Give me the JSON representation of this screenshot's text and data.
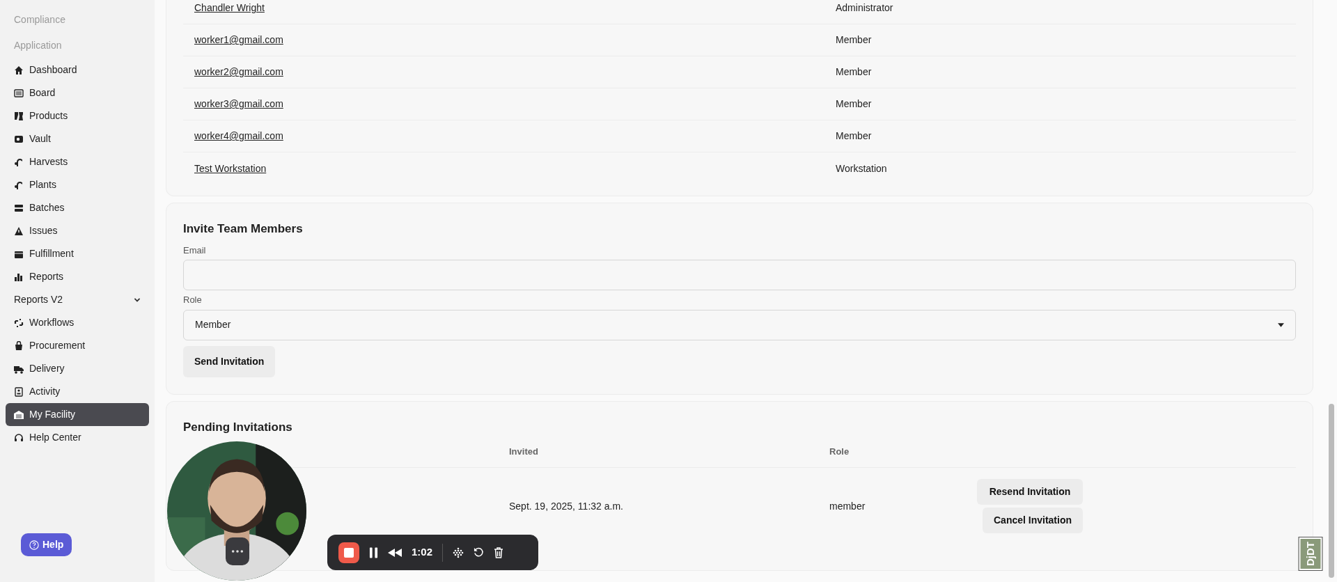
{
  "sidebar": {
    "sections": [
      {
        "label": "Compliance"
      },
      {
        "label": "Application"
      }
    ],
    "items": [
      {
        "label": "Dashboard",
        "kind": "link",
        "selected": false
      },
      {
        "label": "Board",
        "kind": "link",
        "selected": false
      },
      {
        "label": "Products",
        "kind": "link",
        "selected": false
      },
      {
        "label": "Vault",
        "kind": "link",
        "selected": false
      },
      {
        "label": "Harvests",
        "kind": "link",
        "selected": false
      },
      {
        "label": "Plants",
        "kind": "link",
        "selected": false
      },
      {
        "label": "Batches",
        "kind": "link",
        "selected": false
      },
      {
        "label": "Issues",
        "kind": "link",
        "selected": false
      },
      {
        "label": "Fulfillment",
        "kind": "link",
        "selected": false
      },
      {
        "label": "Reports",
        "kind": "link",
        "selected": false
      },
      {
        "label": "Reports V2",
        "kind": "group",
        "selected": false
      },
      {
        "label": "Workflows",
        "kind": "link",
        "selected": false
      },
      {
        "label": "Procurement",
        "kind": "link",
        "selected": false
      },
      {
        "label": "Delivery",
        "kind": "link",
        "selected": false
      },
      {
        "label": "Activity",
        "kind": "link",
        "selected": false
      },
      {
        "label": "My Facility",
        "kind": "link",
        "selected": true
      },
      {
        "label": "Help Center",
        "kind": "link",
        "selected": false
      }
    ],
    "help_button": "Help"
  },
  "members": {
    "rows": [
      {
        "name": "Chandler Wright",
        "role": "Administrator"
      },
      {
        "name": "worker1@gmail.com",
        "role": "Member"
      },
      {
        "name": "worker2@gmail.com",
        "role": "Member"
      },
      {
        "name": "worker3@gmail.com",
        "role": "Member"
      },
      {
        "name": "worker4@gmail.com",
        "role": "Member"
      },
      {
        "name": "Test Workstation",
        "role": "Workstation"
      }
    ]
  },
  "invite": {
    "title": "Invite Team Members",
    "email_label": "Email",
    "role_label": "Role",
    "role_value": "Member",
    "button": "Send Invitation"
  },
  "pending": {
    "title": "Pending Invitations",
    "columns": [
      "Invited",
      "Role"
    ],
    "rows": [
      {
        "invited": "Sept. 19, 2025, 11:32 a.m.",
        "role": "member",
        "actions": [
          "Resend Invitation",
          "Cancel Invitation"
        ]
      }
    ]
  },
  "recording_toolbar": {
    "time": "1:02"
  },
  "debug_toolbar": {
    "label": "DjDT"
  }
}
